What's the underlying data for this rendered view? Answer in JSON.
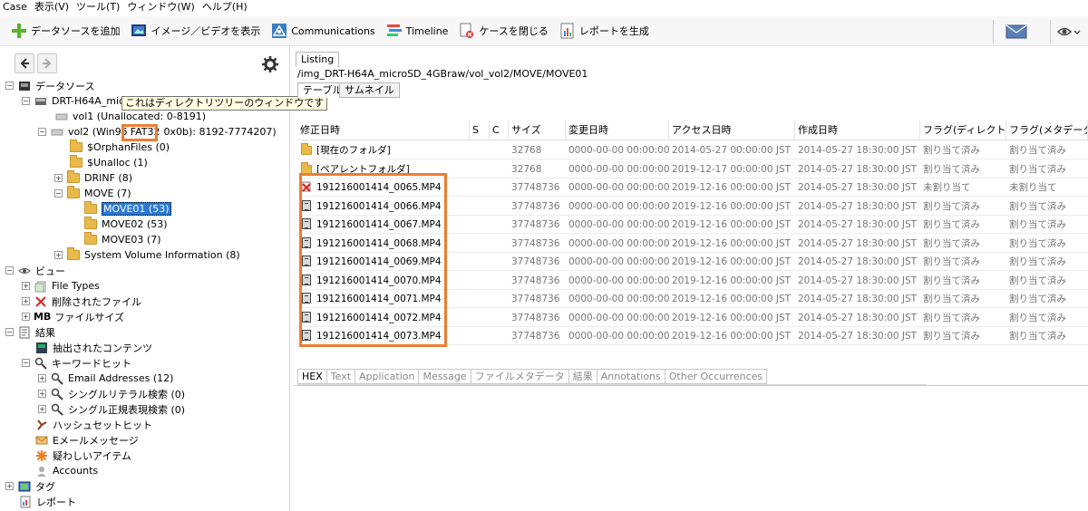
{
  "menu": [
    "Case",
    "表示(V)",
    "ツール(T)",
    "ウィンドウ(W)",
    "ヘルプ(H)"
  ],
  "toolbar": {
    "add_source": "データソースを追加",
    "view_images": "イメージ／ビデオを表示",
    "communications": "Communications",
    "timeline": "Timeline",
    "close_case": "ケースを閉じる",
    "generate_report": "レポートを生成"
  },
  "tree": {
    "datasources": "データソース",
    "device": "DRT-H64A_mic",
    "tooltip": "これはディレクトリツリーのウィンドウです",
    "vol1": "vol1 (Unallocated: 0-8191)",
    "vol2_prefix": "vol2 (Win95",
    "vol2_fat": "FAT32",
    "vol2_suffix": "0x0b): 8192-7774207)",
    "orphan": "$OrphanFiles (0)",
    "unalloc": "$Unalloc (1)",
    "drinf": "DRINF (8)",
    "move": "MOVE (7)",
    "move01": "MOVE01 (53)",
    "move02": "MOVE02 (53)",
    "move03": "MOVE03 (7)",
    "svi": "System Volume Information (8)",
    "views": "ビュー",
    "filetypes": "File Types",
    "deleted": "削除されたファイル",
    "mb": "MB",
    "filesize": "ファイルサイズ",
    "results": "結果",
    "extracted": "抽出されたコンテンツ",
    "keywordhits": "キーワードヒット",
    "email_addr": "Email Addresses (12)",
    "literal": "シングルリテラル検索 (0)",
    "regex": "シングル正規表現検索 (0)",
    "hashset": "ハッシュセットヒット",
    "emailmsg": "Eメールメッセージ",
    "suspicious": "疑わしいアイテム",
    "accounts": "Accounts",
    "tags": "タグ",
    "reports": "レポート"
  },
  "listing": {
    "tab": "Listing",
    "path": "/img_DRT-H64A_microSD_4GBraw/vol_vol2/MOVE/MOVE01",
    "subtabs": [
      "テーブル",
      "サムネイル"
    ],
    "columns": [
      "修正日時",
      "S",
      "C",
      "サイズ",
      "変更日時",
      "アクセス日時",
      "作成日時",
      "フラグ(ディレクトリ)",
      "フラグ(メタデータ)"
    ],
    "rows": [
      {
        "name": "[現在のフォルダ]",
        "size": "32768",
        "mod": "0000-00-00 00:00:00",
        "acc": "2014-05-27 00:00:00 JST",
        "cre": "2014-05-27 18:30:00 JST",
        "fdir": "割り当て済み",
        "fmeta": "割り当て済み"
      },
      {
        "name": "[ペアレントフォルダ]",
        "size": "32768",
        "mod": "0000-00-00 00:00:00",
        "acc": "2019-12-17 00:00:00 JST",
        "cre": "2014-05-27 18:30:00 JST",
        "fdir": "割り当て済み",
        "fmeta": "割り当て済み"
      },
      {
        "name": "191216001414_0065.MP4",
        "size": "37748736",
        "mod": "0000-00-00 00:00:00",
        "acc": "2019-12-16 00:00:00 JST",
        "cre": "2014-05-27 18:30:00 JST",
        "fdir": "未割り当て",
        "fmeta": "未割り当て"
      },
      {
        "name": "191216001414_0066.MP4",
        "size": "37748736",
        "mod": "0000-00-00 00:00:00",
        "acc": "2019-12-16 00:00:00 JST",
        "cre": "2014-05-27 18:30:00 JST",
        "fdir": "割り当て済み",
        "fmeta": "割り当て済み"
      },
      {
        "name": "191216001414_0067.MP4",
        "size": "37748736",
        "mod": "0000-00-00 00:00:00",
        "acc": "2019-12-16 00:00:00 JST",
        "cre": "2014-05-27 18:30:00 JST",
        "fdir": "割り当て済み",
        "fmeta": "割り当て済み"
      },
      {
        "name": "191216001414_0068.MP4",
        "size": "37748736",
        "mod": "0000-00-00 00:00:00",
        "acc": "2019-12-16 00:00:00 JST",
        "cre": "2014-05-27 18:30:00 JST",
        "fdir": "割り当て済み",
        "fmeta": "割り当て済み"
      },
      {
        "name": "191216001414_0069.MP4",
        "size": "37748736",
        "mod": "0000-00-00 00:00:00",
        "acc": "2019-12-16 00:00:00 JST",
        "cre": "2014-05-27 18:30:00 JST",
        "fdir": "割り当て済み",
        "fmeta": "割り当て済み"
      },
      {
        "name": "191216001414_0070.MP4",
        "size": "37748736",
        "mod": "0000-00-00 00:00:00",
        "acc": "2019-12-16 00:00:00 JST",
        "cre": "2014-05-27 18:30:00 JST",
        "fdir": "割り当て済み",
        "fmeta": "割り当て済み"
      },
      {
        "name": "191216001414_0071.MP4",
        "size": "37748736",
        "mod": "0000-00-00 00:00:00",
        "acc": "2019-12-16 00:00:00 JST",
        "cre": "2014-05-27 18:30:00 JST",
        "fdir": "割り当て済み",
        "fmeta": "割り当て済み"
      },
      {
        "name": "191216001414_0072.MP4",
        "size": "37748736",
        "mod": "0000-00-00 00:00:00",
        "acc": "2019-12-16 00:00:00 JST",
        "cre": "2014-05-27 18:30:00 JST",
        "fdir": "割り当て済み",
        "fmeta": "割り当て済み"
      },
      {
        "name": "191216001414_0073.MP4",
        "size": "37748736",
        "mod": "0000-00-00 00:00:00",
        "acc": "2019-12-16 00:00:00 JST",
        "cre": "2014-05-27 18:30:00 JST",
        "fdir": "割り当て済み",
        "fmeta": "割り当て済み"
      }
    ]
  },
  "bottom_tabs": [
    "HEX",
    "Text",
    "Application",
    "Message",
    "ファイルメタデータ",
    "結果",
    "Annotations",
    "Other Occurrences"
  ],
  "colors": {
    "highlight": "#ed7d31",
    "selection": "#2d78d0"
  }
}
